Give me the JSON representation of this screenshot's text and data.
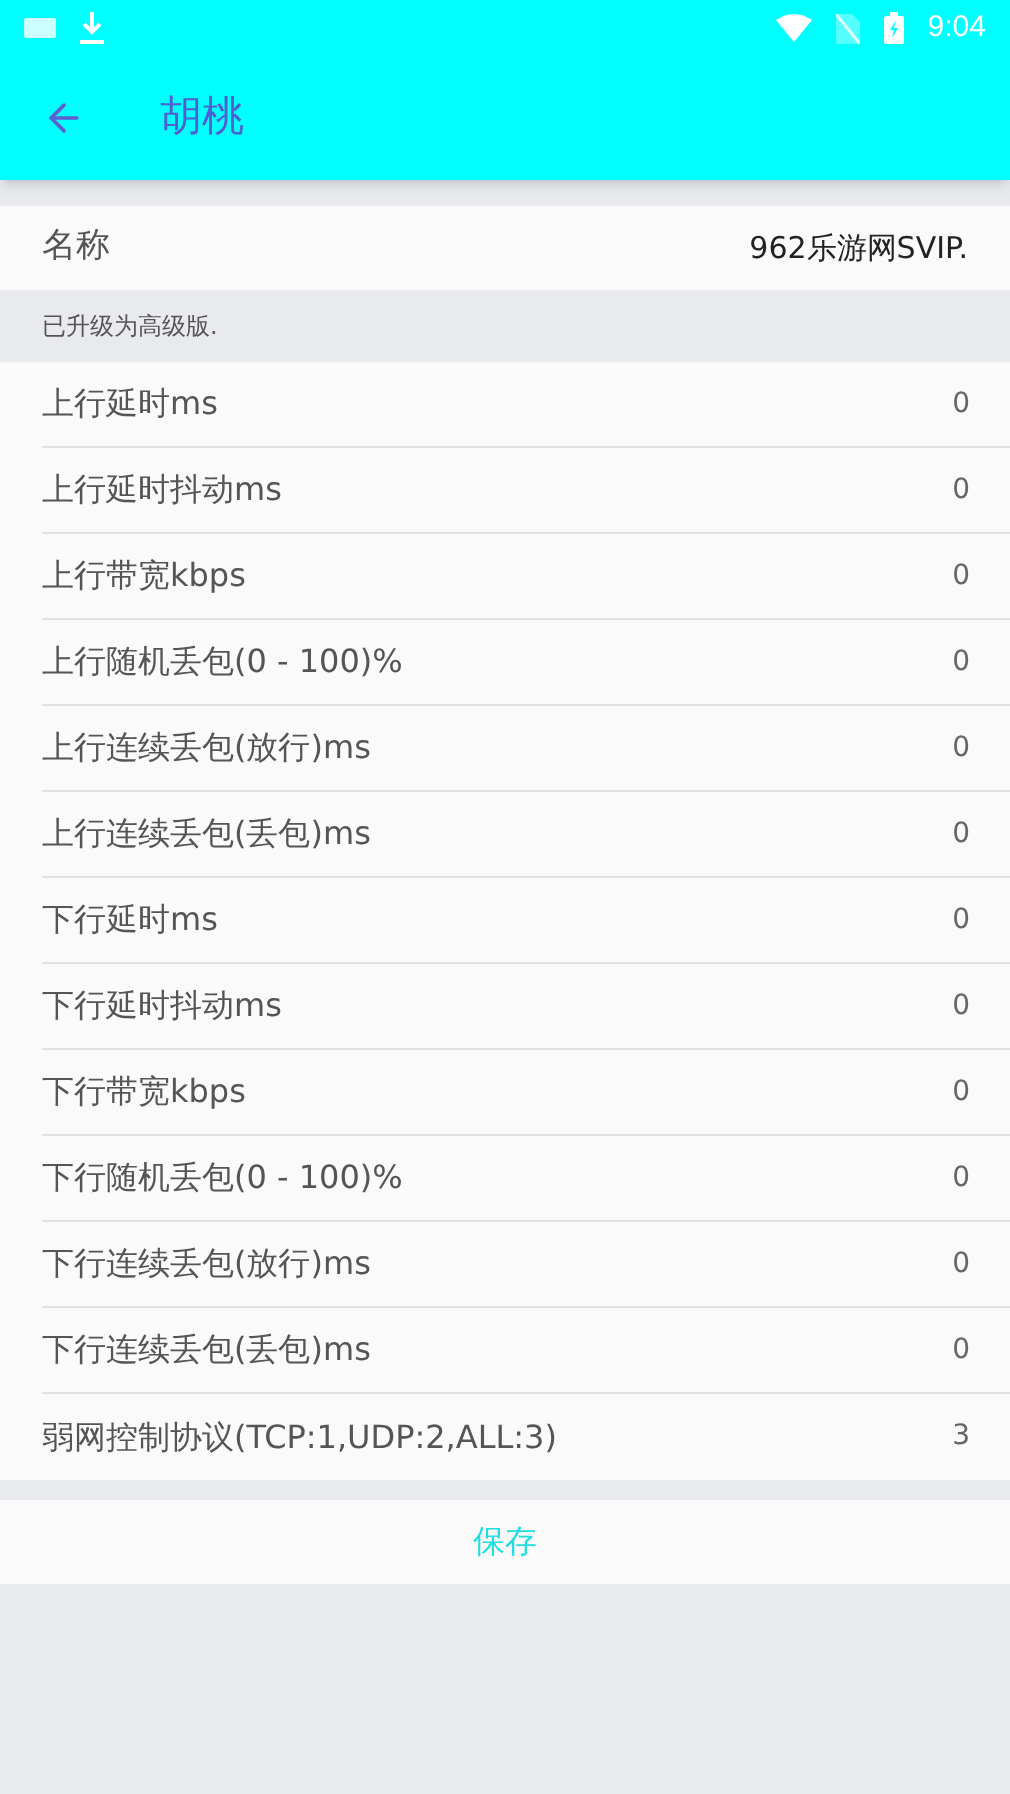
{
  "status_bar": {
    "time": "9:04"
  },
  "app_bar": {
    "title": "胡桃"
  },
  "name_field": {
    "label": "名称",
    "value": "962乐游网SVIP."
  },
  "note": "已升级为高级版.",
  "settings": [
    {
      "label": "上行延时ms",
      "value": "0"
    },
    {
      "label": "上行延时抖动ms",
      "value": "0"
    },
    {
      "label": "上行带宽kbps",
      "value": "0"
    },
    {
      "label": "上行随机丢包(0 - 100)%",
      "value": "0"
    },
    {
      "label": "上行连续丢包(放行)ms",
      "value": "0"
    },
    {
      "label": "上行连续丢包(丢包)ms",
      "value": "0"
    },
    {
      "label": "下行延时ms",
      "value": "0"
    },
    {
      "label": "下行延时抖动ms",
      "value": "0"
    },
    {
      "label": "下行带宽kbps",
      "value": "0"
    },
    {
      "label": "下行随机丢包(0 - 100)%",
      "value": "0"
    },
    {
      "label": "下行连续丢包(放行)ms",
      "value": "0"
    },
    {
      "label": "下行连续丢包(丢包)ms",
      "value": "0"
    },
    {
      "label": "弱网控制协议(TCP:1,UDP:2,ALL:3)",
      "value": "3"
    }
  ],
  "save_button": "保存"
}
